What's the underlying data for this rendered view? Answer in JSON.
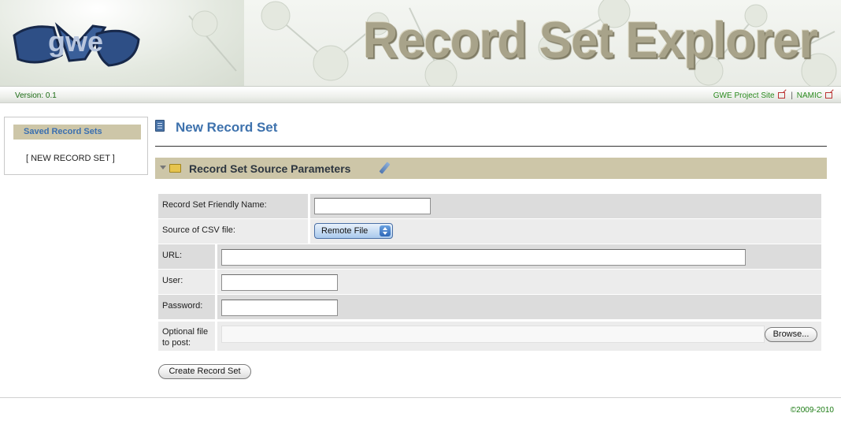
{
  "header": {
    "logo_text": "gwe",
    "app_title": "Record Set Explorer",
    "version_label": "Version:",
    "version_value": "0.1",
    "links": [
      {
        "label": "GWE Project Site",
        "icon": "external-link-icon"
      },
      {
        "label": "NAMIC",
        "icon": "external-link-icon"
      }
    ],
    "link_separator": "|"
  },
  "sidebar": {
    "heading": "Saved Record Sets",
    "items": [
      {
        "label": "[ NEW RECORD SET ]"
      }
    ]
  },
  "main": {
    "title": "New Record Set",
    "title_icon": "document-icon",
    "section": {
      "label": "Record Set Source Parameters",
      "icons": [
        "collapse-triangle-icon",
        "folder-open-icon",
        "edit-pencil-icon"
      ]
    },
    "form": {
      "friendly_name": {
        "label": "Record Set Friendly Name:",
        "value": ""
      },
      "source": {
        "label": "Source of CSV file:",
        "selected": "Remote File"
      },
      "url": {
        "label": "URL:",
        "value": ""
      },
      "user": {
        "label": "User:",
        "value": ""
      },
      "password": {
        "label": "Password:",
        "value": ""
      },
      "optional_file": {
        "label_line1": "Optional file",
        "label_line2": "to post:",
        "browse_label": "Browse..."
      }
    },
    "submit_label": "Create Record Set"
  },
  "footer": {
    "copyright": "©2009-2010"
  },
  "colors": {
    "accent_blue": "#3e72ad",
    "section_tan": "#cdc6a8",
    "link_green": "#2a8a1e"
  }
}
